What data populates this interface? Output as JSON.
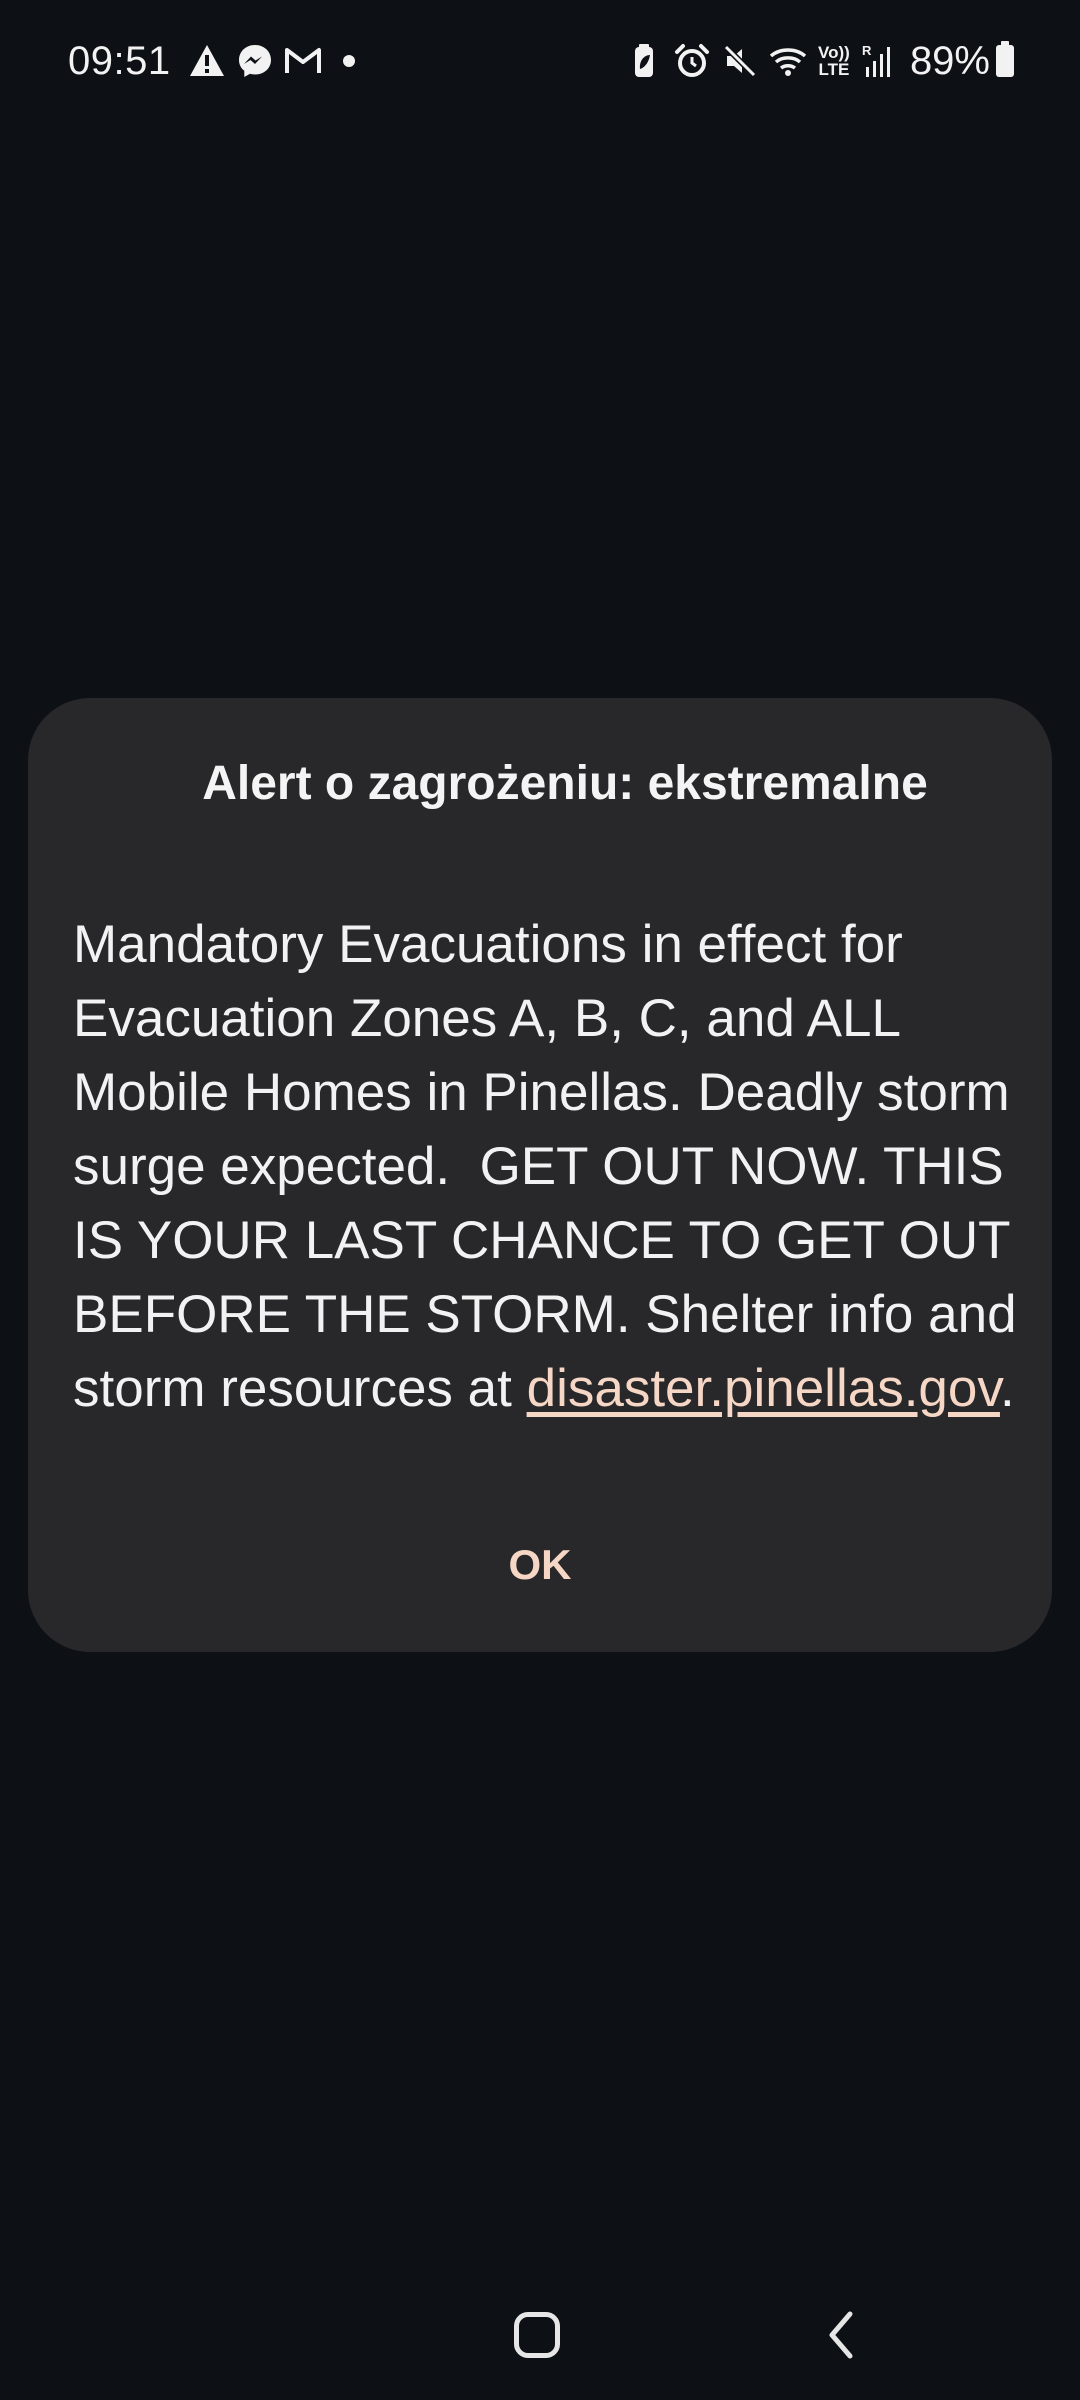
{
  "status_bar": {
    "time": "09:51",
    "notification_icons": [
      "warning-icon",
      "messenger-icon",
      "gmail-icon",
      "more-dot-icon"
    ],
    "system_icons": [
      "battery-saver-icon",
      "alarm-icon",
      "mute-icon",
      "wifi-icon",
      "volte-icon",
      "signal-icon"
    ],
    "volte_label_top": "Vo))",
    "volte_label_bottom": "LTE",
    "battery_percent": "89%"
  },
  "dialog": {
    "title": "Alert o zagrożeniu: ekstremalne",
    "message_text": "Mandatory Evacuations in effect for Evacuation Zones A, B, C, and ALL Mobile Homes in Pinellas. Deadly storm surge expected.  GET OUT NOW. THIS IS YOUR LAST CHANCE TO GET OUT BEFORE THE STORM. Shelter info and storm resources at ",
    "link_text": "disaster.pinellas.gov",
    "message_end": ".",
    "ok_label": "OK"
  },
  "navigation_bar": {
    "buttons": [
      "home-button",
      "back-button"
    ]
  },
  "colors": {
    "background": "#0d1115",
    "dialog_background": "#28282a",
    "accent": "#f6d7c6",
    "text": "#f2f2f2"
  }
}
